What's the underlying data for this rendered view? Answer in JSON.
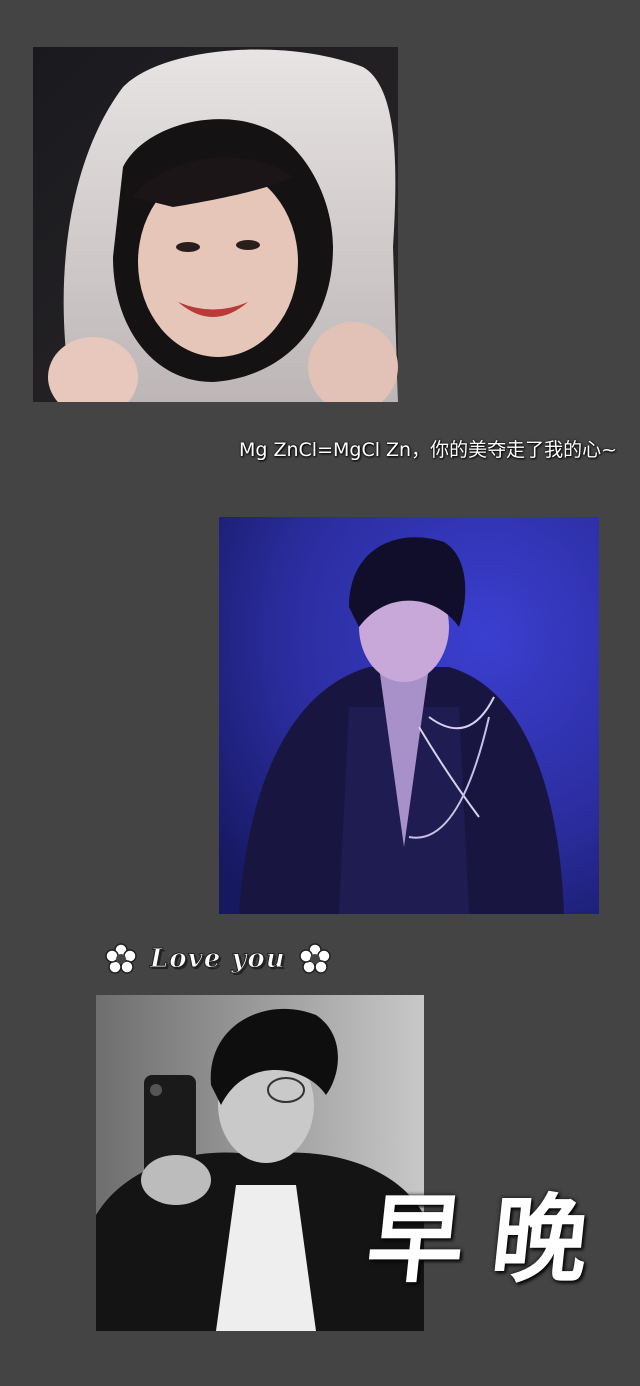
{
  "caption": "Mg ZnCl=MgCl Zn，你的美夺走了我的心~",
  "love_label": "Love you",
  "signature": [
    "早",
    "晚"
  ],
  "photos": [
    {
      "name": "hooded-towel-photo"
    },
    {
      "name": "stage-performance-photo"
    },
    {
      "name": "mirror-selfie-photo"
    }
  ],
  "colors": {
    "background": "#444444",
    "text": "#ffffff",
    "stage_blue": "#2c2fa8"
  }
}
